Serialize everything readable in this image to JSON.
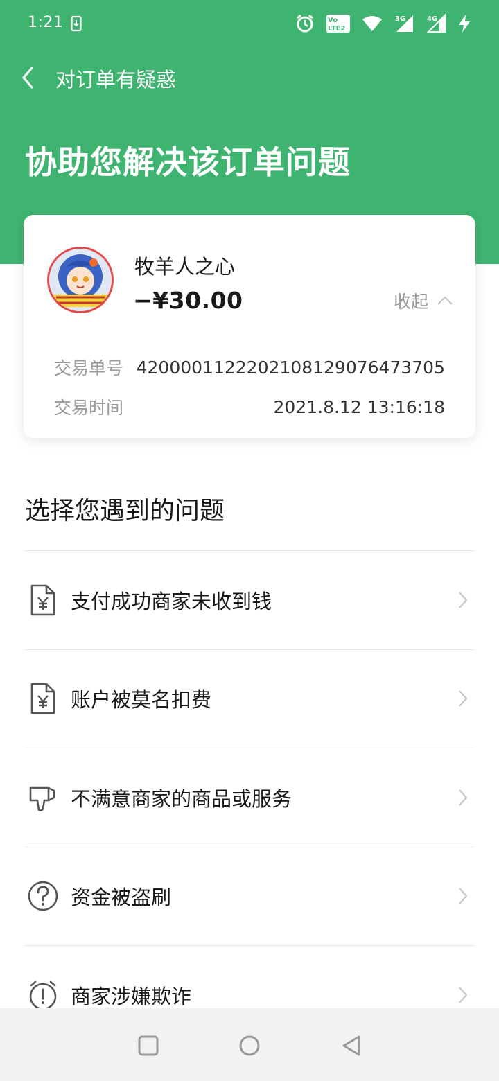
{
  "status_bar": {
    "time": "1:21",
    "icons": [
      "download-icon",
      "alarm-icon",
      "volte-icon",
      "wifi-icon",
      "signal-3g-icon",
      "signal-4g-icon",
      "charging-icon"
    ],
    "lte_badge_top": "Vo",
    "lte_badge_bottom": "LTE2",
    "net1": "3G",
    "net2": "4G"
  },
  "header": {
    "title": "对订单有疑惑",
    "hero": "协助您解决该订单问题"
  },
  "order": {
    "merchant": "牧羊人之心",
    "amount": "−¥30.00",
    "collapse_label": "收起",
    "transaction_id_label": "交易单号",
    "transaction_id": "4200001122202108129076473705",
    "transaction_time_label": "交易时间",
    "transaction_time": "2021.8.12 13:16:18"
  },
  "issues": {
    "title": "选择您遇到的问题",
    "items": [
      {
        "label": "支付成功商家未收到钱",
        "icon": "yuan-document-icon"
      },
      {
        "label": "账户被莫名扣费",
        "icon": "yuan-document-icon"
      },
      {
        "label": "不满意商家的商品或服务",
        "icon": "thumbs-down-icon"
      },
      {
        "label": "资金被盗刷",
        "icon": "question-circle-icon"
      },
      {
        "label": "商家涉嫌欺诈",
        "icon": "alert-clock-icon"
      }
    ]
  },
  "colors": {
    "brand_green": "#3fb471",
    "muted_text": "#9a9a9a"
  }
}
